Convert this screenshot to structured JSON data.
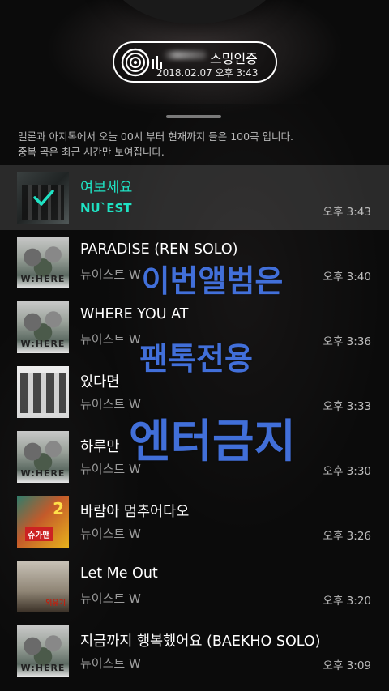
{
  "header": {
    "badge_title": "스밍인증",
    "badge_datetime": "2018.02.07 오후 3:43"
  },
  "notice": {
    "line1": "멜론과 아지톡에서 오늘 00시 부터 현재까지 들은 100곡 입니다.",
    "line2": "중복 곡은 최근 시간만 보여집니다."
  },
  "tracks": [
    {
      "title": "여보세요",
      "artist": "NU`EST",
      "time": "오후 3:43"
    },
    {
      "title": "PARADISE (REN SOLO)",
      "artist": "뉴이스트 W",
      "time": "오후 3:40"
    },
    {
      "title": "WHERE YOU AT",
      "artist": "뉴이스트 W",
      "time": "오후 3:36"
    },
    {
      "title": "있다면",
      "artist": "뉴이스트 W",
      "time": "오후 3:33"
    },
    {
      "title": "하루만",
      "artist": "뉴이스트 W",
      "time": "오후 3:30"
    },
    {
      "title": "바람아 멈추어다오",
      "artist": "뉴이스트 W",
      "time": "오후 3:26"
    },
    {
      "title": "Let Me Out",
      "artist": "뉴이스트 W",
      "time": "오후 3:20"
    },
    {
      "title": "지금까지 행복했어요 (BAEKHO SOLO)",
      "artist": "뉴이스트 W",
      "time": "오후 3:09"
    }
  ],
  "album_art": {
    "where_label": "W:HERE",
    "sugar_number": "2",
    "sugar_label": "슈가맨",
    "outside_label": "외유기"
  },
  "watermark": {
    "line1": "이번앨범은",
    "line2": "팬톡전용",
    "line3": "엔터금지"
  },
  "colors": {
    "accent": "#1fe3c4",
    "watermark": "#4678eb"
  }
}
